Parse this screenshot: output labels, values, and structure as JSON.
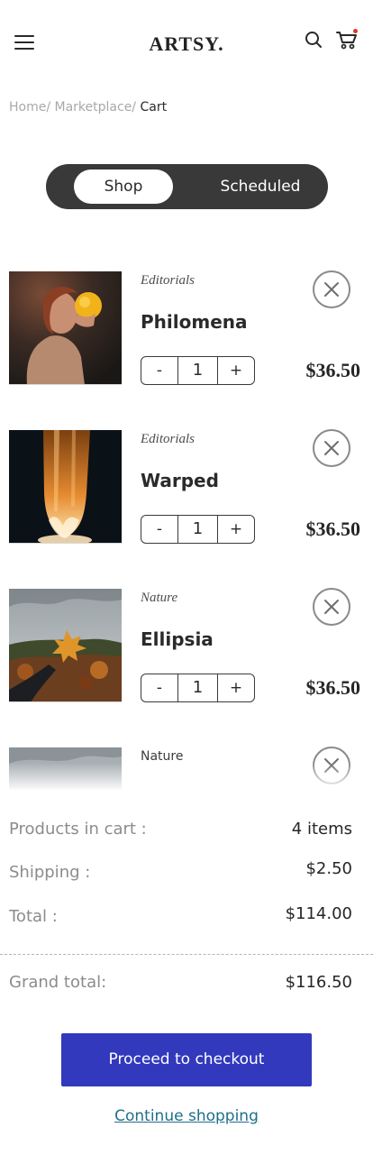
{
  "header": {
    "logo": "ARTSY."
  },
  "breadcrumb": {
    "home": "Home/",
    "marketplace": "Marketplace/",
    "current": "Cart"
  },
  "toggle": {
    "active": "Shop",
    "inactive": "Scheduled"
  },
  "cart_items": [
    {
      "category": "Editorials",
      "name": "Philomena",
      "quantity": "1",
      "price": "$36.50"
    },
    {
      "category": "Editorials",
      "name": "Warped",
      "quantity": "1",
      "price": "$36.50"
    },
    {
      "category": "Nature",
      "name": "Ellipsia",
      "quantity": "1",
      "price": "$36.50"
    },
    {
      "category": "Nature"
    }
  ],
  "stepper": {
    "minus": "-",
    "plus": "+"
  },
  "summary": {
    "products_label": "Products in cart :",
    "products_value": "4 items",
    "shipping_label": "Shipping :",
    "shipping_value": "$2.50",
    "total_label": "Total :",
    "total_value": "$114.00",
    "grand_label": "Grand total:",
    "grand_value": "$116.50",
    "checkout_label": "Proceed to checkout",
    "continue_label": "Continue shopping"
  },
  "colors": {
    "accent": "#3239bd",
    "toggle_bg": "#393939",
    "link": "#1f6f89",
    "notification_dot": "#e2372b"
  },
  "icons": [
    "menu-icon",
    "search-icon",
    "cart-icon",
    "close-icon"
  ]
}
